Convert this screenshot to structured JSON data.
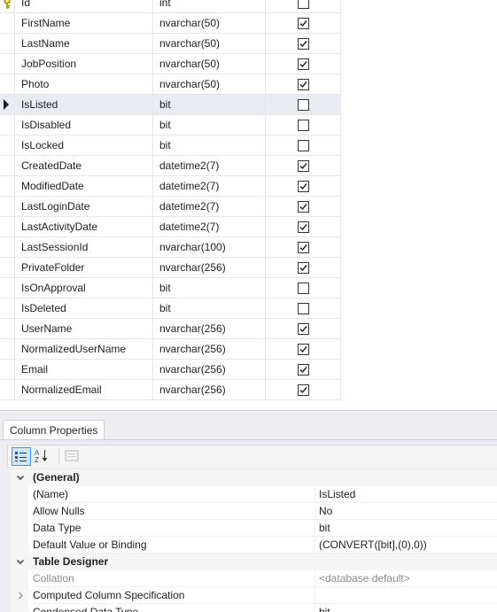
{
  "grid": {
    "columns": [
      {
        "name": "Id",
        "type": "int",
        "allow_nulls": false,
        "primary_key": true
      },
      {
        "name": "FirstName",
        "type": "nvarchar(50)",
        "allow_nulls": true
      },
      {
        "name": "LastName",
        "type": "nvarchar(50)",
        "allow_nulls": true
      },
      {
        "name": "JobPosition",
        "type": "nvarchar(50)",
        "allow_nulls": true
      },
      {
        "name": "Photo",
        "type": "nvarchar(50)",
        "allow_nulls": true
      },
      {
        "name": "IsListed",
        "type": "bit",
        "allow_nulls": false,
        "selected": true
      },
      {
        "name": "IsDisabled",
        "type": "bit",
        "allow_nulls": false
      },
      {
        "name": "IsLocked",
        "type": "bit",
        "allow_nulls": false
      },
      {
        "name": "CreatedDate",
        "type": "datetime2(7)",
        "allow_nulls": true
      },
      {
        "name": "ModifiedDate",
        "type": "datetime2(7)",
        "allow_nulls": true
      },
      {
        "name": "LastLoginDate",
        "type": "datetime2(7)",
        "allow_nulls": true
      },
      {
        "name": "LastActivityDate",
        "type": "datetime2(7)",
        "allow_nulls": true
      },
      {
        "name": "LastSessionId",
        "type": "nvarchar(100)",
        "allow_nulls": true
      },
      {
        "name": "PrivateFolder",
        "type": "nvarchar(256)",
        "allow_nulls": true
      },
      {
        "name": "IsOnApproval",
        "type": "bit",
        "allow_nulls": false
      },
      {
        "name": "IsDeleted",
        "type": "bit",
        "allow_nulls": false
      },
      {
        "name": "UserName",
        "type": "nvarchar(256)",
        "allow_nulls": true
      },
      {
        "name": "NormalizedUserName",
        "type": "nvarchar(256)",
        "allow_nulls": true
      },
      {
        "name": "Email",
        "type": "nvarchar(256)",
        "allow_nulls": true
      },
      {
        "name": "NormalizedEmail",
        "type": "nvarchar(256)",
        "allow_nulls": true
      }
    ]
  },
  "properties": {
    "tab_label": "Column Properties",
    "toolbar": {
      "categorized_icon": "categorized-icon",
      "alphabetical_icon": "alphabetical-icon",
      "property_pages_icon": "property-pages-icon"
    },
    "rows": [
      {
        "kind": "category",
        "expander": "expanded",
        "name": "(General)",
        "value": ""
      },
      {
        "kind": "property",
        "name": "(Name)",
        "value": "IsListed"
      },
      {
        "kind": "property",
        "name": "Allow Nulls",
        "value": "No"
      },
      {
        "kind": "property",
        "name": "Data Type",
        "value": "bit"
      },
      {
        "kind": "property",
        "name": "Default Value or Binding",
        "value": "(CONVERT([bit],(0),0))"
      },
      {
        "kind": "category",
        "expander": "expanded",
        "name": "Table Designer",
        "value": ""
      },
      {
        "kind": "property",
        "name": "Collation",
        "value": "<database default>",
        "dim": true
      },
      {
        "kind": "property",
        "expander": "collapsed",
        "name": "Computed Column Specification",
        "value": ""
      },
      {
        "kind": "property",
        "name": "Condensed Data Type",
        "value": "bit"
      }
    ]
  },
  "colors": {
    "selected_row": "#e8ebef",
    "grid_line": "#e6e6e6",
    "panel_background": "#eeeef2",
    "toolbar_active": "#cce8ff",
    "key_icon": "#e8c51c"
  }
}
